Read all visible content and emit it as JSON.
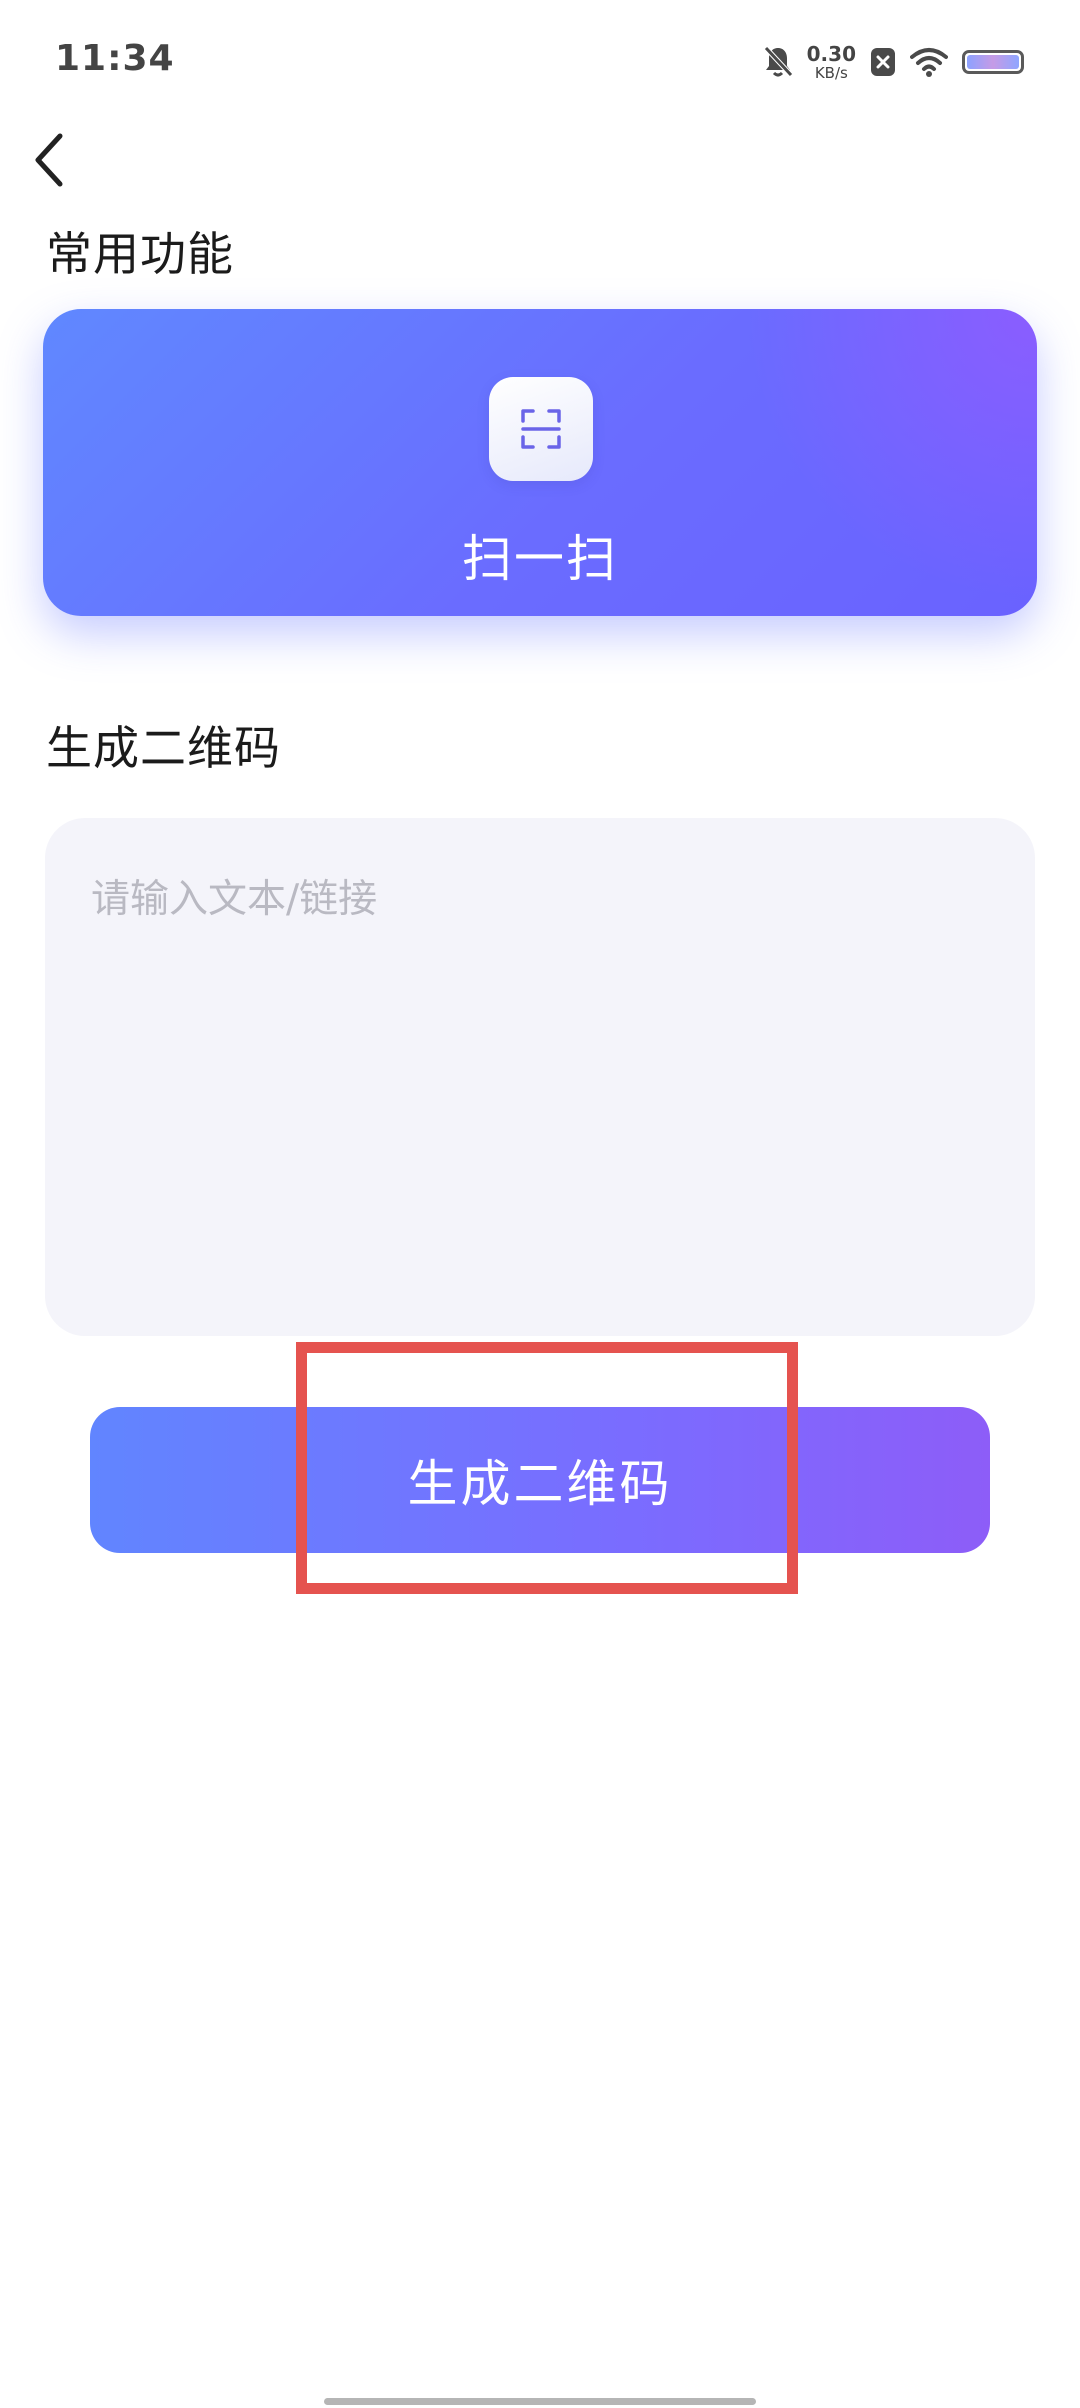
{
  "status_bar": {
    "time": "11:34",
    "net_speed_value": "0.30",
    "net_speed_unit": "KB/s",
    "icons": [
      "bell-off-icon",
      "close-box-icon",
      "wifi-icon",
      "battery-icon"
    ]
  },
  "nav": {
    "back_icon": "chevron-left-icon"
  },
  "sections": {
    "common_title": "常用功能",
    "generate_title": "生成二维码"
  },
  "scan_card": {
    "icon": "scan-frame-icon",
    "label": "扫一扫"
  },
  "text_input": {
    "value": "",
    "placeholder": "请输入文本/链接"
  },
  "generate_button": {
    "label": "生成二维码"
  },
  "colors": {
    "accent_start": "#6185ff",
    "accent_end": "#8d5df8",
    "highlight": "#e5534f",
    "input_bg": "#f4f4fa"
  }
}
